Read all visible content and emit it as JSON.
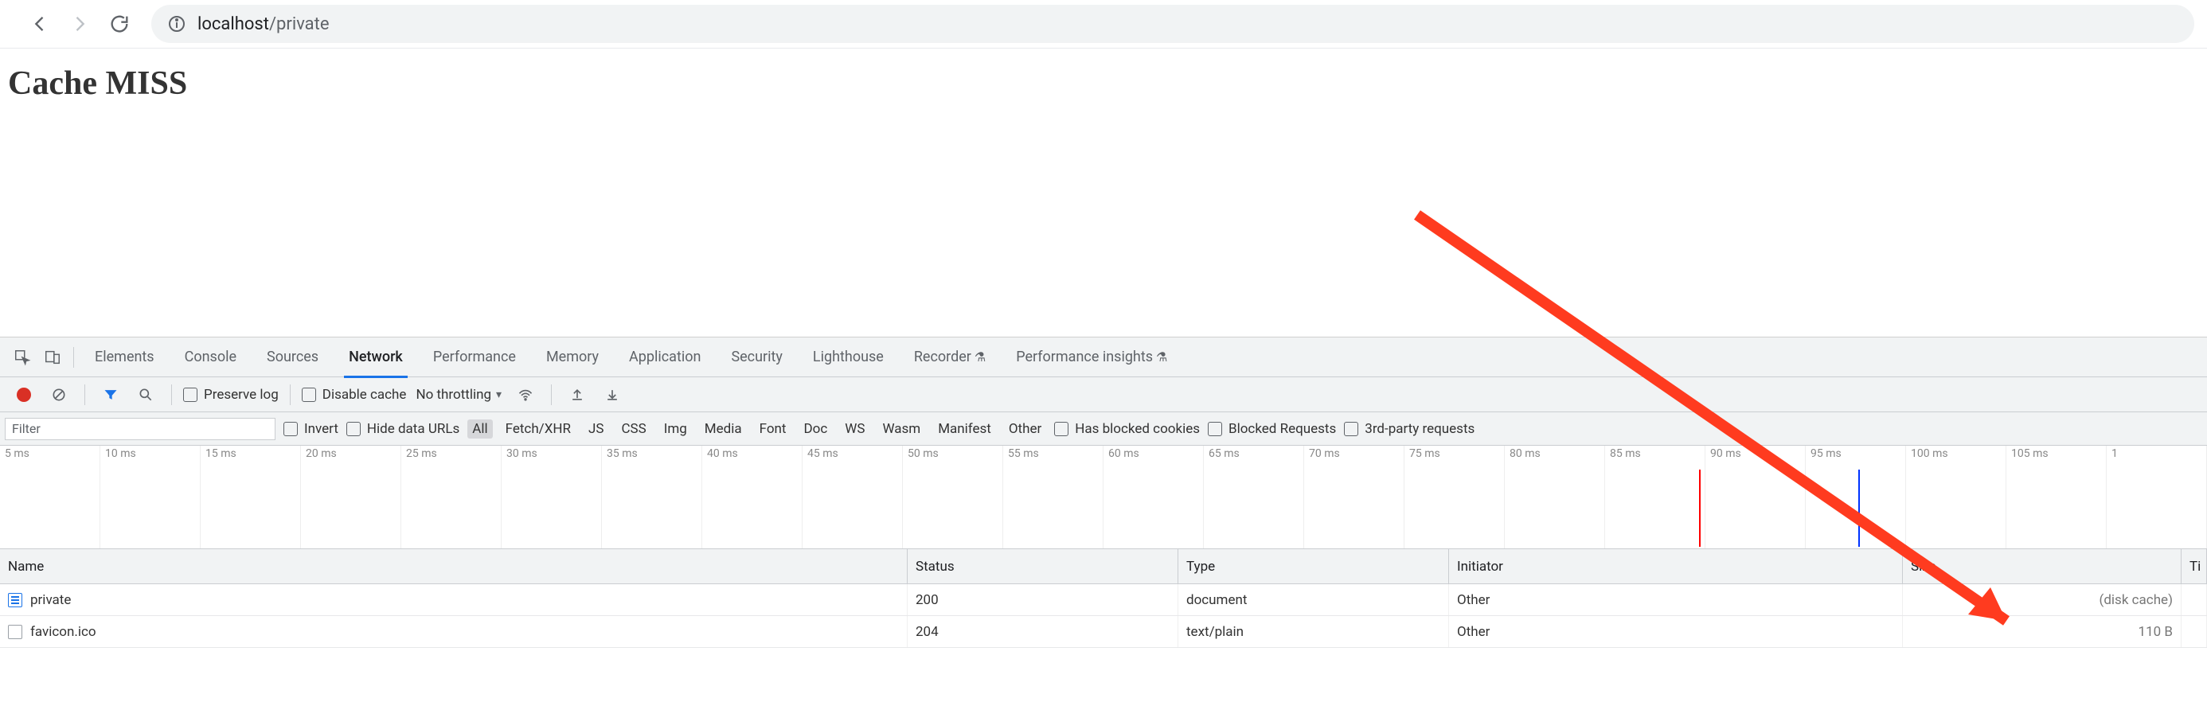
{
  "browser": {
    "url_host": "localhost",
    "url_path": "/private"
  },
  "page": {
    "heading": "Cache MISS"
  },
  "devtools": {
    "tabs": [
      "Elements",
      "Console",
      "Sources",
      "Network",
      "Performance",
      "Memory",
      "Application",
      "Security",
      "Lighthouse",
      "Recorder",
      "Performance insights"
    ],
    "active_tab": "Network",
    "controls": {
      "preserve_log": "Preserve log",
      "disable_cache": "Disable cache",
      "throttling": "No throttling"
    },
    "filter": {
      "placeholder": "Filter",
      "invert": "Invert",
      "hide_data_urls": "Hide data URLs",
      "types": [
        "All",
        "Fetch/XHR",
        "JS",
        "CSS",
        "Img",
        "Media",
        "Font",
        "Doc",
        "WS",
        "Wasm",
        "Manifest",
        "Other"
      ],
      "selected_type": "All",
      "has_blocked_cookies": "Has blocked cookies",
      "blocked_requests": "Blocked Requests",
      "third_party": "3rd-party requests"
    },
    "overview_ticks": [
      "5 ms",
      "10 ms",
      "15 ms",
      "20 ms",
      "25 ms",
      "30 ms",
      "35 ms",
      "40 ms",
      "45 ms",
      "50 ms",
      "55 ms",
      "60 ms",
      "65 ms",
      "70 ms",
      "75 ms",
      "80 ms",
      "85 ms",
      "90 ms",
      "95 ms",
      "100 ms",
      "105 ms",
      "1"
    ],
    "columns": [
      "Name",
      "Status",
      "Type",
      "Initiator",
      "Size",
      "Ti"
    ],
    "rows": [
      {
        "name": "private",
        "status": "200",
        "type": "document",
        "initiator": "Other",
        "size": "(disk cache)",
        "icon": "doc"
      },
      {
        "name": "favicon.ico",
        "status": "204",
        "type": "text/plain",
        "initiator": "Other",
        "size": "110 B",
        "icon": "file"
      }
    ]
  }
}
